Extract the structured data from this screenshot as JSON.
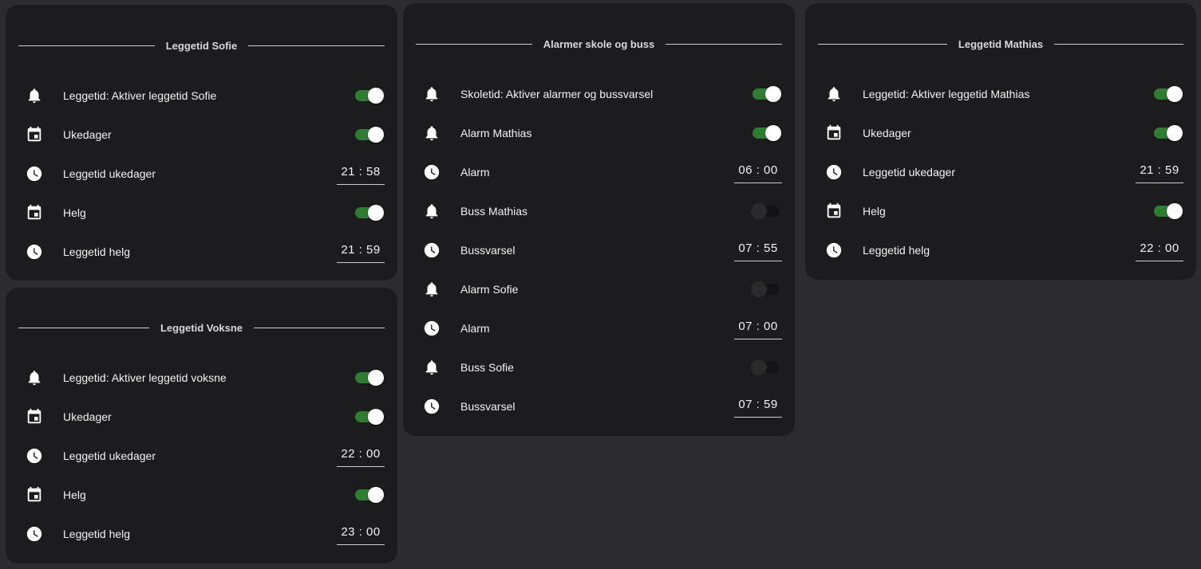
{
  "cards": {
    "sofie": {
      "title": "Leggetid Sofie",
      "rows": [
        {
          "label": "Leggetid: Aktiver leggetid Sofie",
          "icon": "bell-icon",
          "type": "toggle",
          "on": true
        },
        {
          "label": "Ukedager",
          "icon": "calendar-icon",
          "type": "toggle",
          "on": true
        },
        {
          "label": "Leggetid ukedager",
          "icon": "clock-icon",
          "type": "time",
          "time": "21 : 58"
        },
        {
          "label": "Helg",
          "icon": "calendar-icon",
          "type": "toggle",
          "on": true
        },
        {
          "label": "Leggetid helg",
          "icon": "clock-icon",
          "type": "time",
          "time": "21 : 59"
        }
      ]
    },
    "voksne": {
      "title": "Leggetid Voksne",
      "rows": [
        {
          "label": "Leggetid: Aktiver leggetid voksne",
          "icon": "bell-icon",
          "type": "toggle",
          "on": true
        },
        {
          "label": "Ukedager",
          "icon": "calendar-icon",
          "type": "toggle",
          "on": true
        },
        {
          "label": "Leggetid ukedager",
          "icon": "clock-icon",
          "type": "time",
          "time": "22 : 00"
        },
        {
          "label": "Helg",
          "icon": "calendar-icon",
          "type": "toggle",
          "on": true
        },
        {
          "label": "Leggetid helg",
          "icon": "clock-icon",
          "type": "time",
          "time": "23 : 00"
        }
      ]
    },
    "alarmer": {
      "title": "Alarmer skole og buss",
      "rows": [
        {
          "label": "Skoletid: Aktiver alarmer og bussvarsel",
          "icon": "bell-icon",
          "type": "toggle",
          "on": true
        },
        {
          "label": "Alarm Mathias",
          "icon": "bell-icon",
          "type": "toggle",
          "on": true
        },
        {
          "label": "Alarm",
          "icon": "clock-icon",
          "type": "time",
          "time": "06 : 00"
        },
        {
          "label": "Buss Mathias",
          "icon": "bell-icon",
          "type": "toggle",
          "on": false
        },
        {
          "label": "Bussvarsel",
          "icon": "clock-icon",
          "type": "time",
          "time": "07 : 55"
        },
        {
          "label": "Alarm Sofie",
          "icon": "bell-icon",
          "type": "toggle",
          "on": false
        },
        {
          "label": "Alarm",
          "icon": "clock-icon",
          "type": "time",
          "time": "07 : 00"
        },
        {
          "label": "Buss Sofie",
          "icon": "bell-icon",
          "type": "toggle",
          "on": false
        },
        {
          "label": "Bussvarsel",
          "icon": "clock-icon",
          "type": "time",
          "time": "07 : 59"
        }
      ]
    },
    "mathias": {
      "title": "Leggetid Mathias",
      "rows": [
        {
          "label": "Leggetid: Aktiver leggetid Mathias",
          "icon": "bell-icon",
          "type": "toggle",
          "on": true
        },
        {
          "label": "Ukedager",
          "icon": "calendar-icon",
          "type": "toggle",
          "on": true
        },
        {
          "label": "Leggetid ukedager",
          "icon": "clock-icon",
          "type": "time",
          "time": "21 : 59"
        },
        {
          "label": "Helg",
          "icon": "calendar-icon",
          "type": "toggle",
          "on": true
        },
        {
          "label": "Leggetid helg",
          "icon": "clock-icon",
          "type": "time",
          "time": "22 : 00"
        }
      ]
    }
  },
  "colors": {
    "background": "#2c2c2e",
    "card": "#1c1c1e",
    "toggle_on": "#2e7d32",
    "toggle_off": "#141414"
  }
}
